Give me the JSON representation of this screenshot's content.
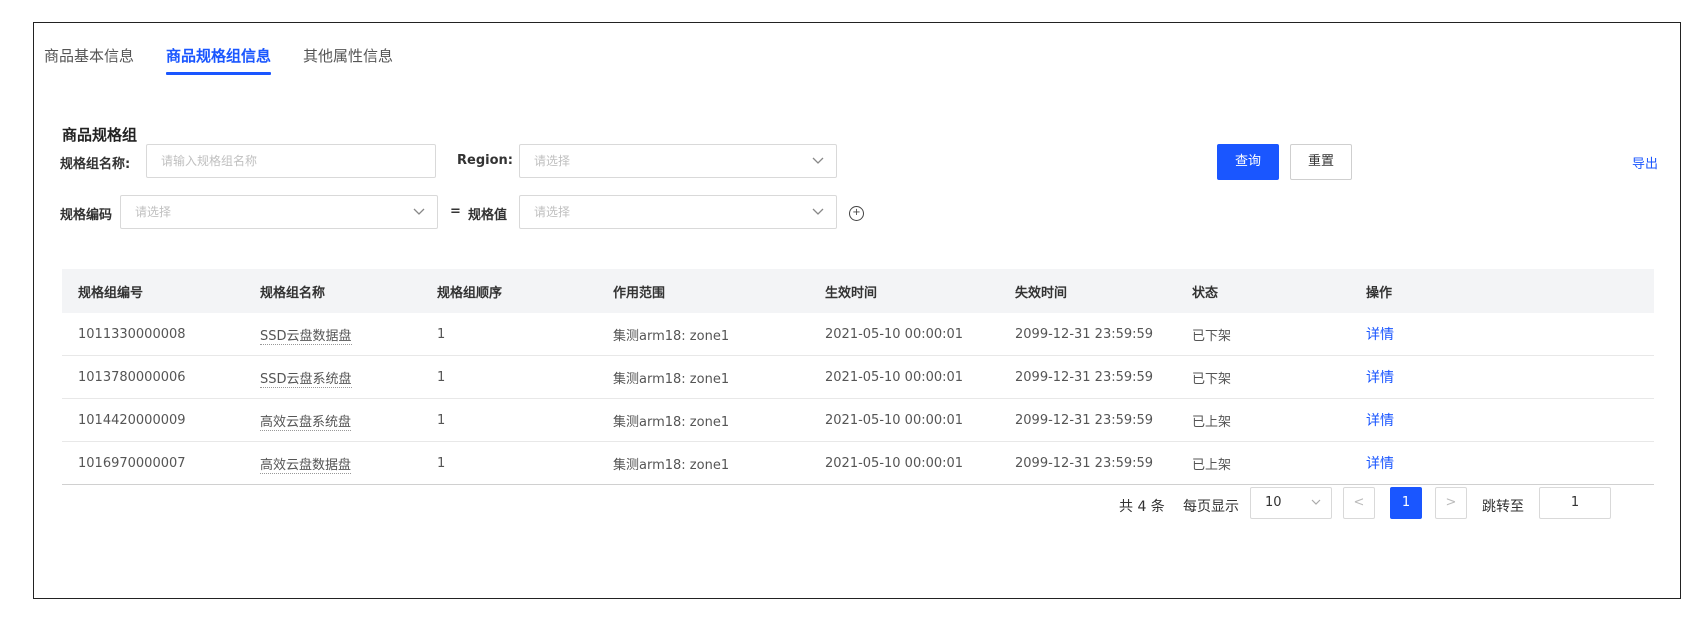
{
  "tabs": [
    {
      "label": "商品基本信息",
      "active": false
    },
    {
      "label": "商品规格组信息",
      "active": true
    },
    {
      "label": "其他属性信息",
      "active": false
    }
  ],
  "section_title": "商品规格组",
  "filters": {
    "group_name_label": "规格组名称:",
    "group_name_placeholder": "请输入规格组名称",
    "region_label": "Region:",
    "region_placeholder": "请选择",
    "spec_code_label": "规格编码",
    "spec_code_placeholder": "请选择",
    "equals": "=",
    "spec_value_label": "规格值",
    "spec_value_placeholder": "请选择"
  },
  "buttons": {
    "query": "查询",
    "reset": "重置",
    "export": "导出"
  },
  "table": {
    "headers": [
      "规格组编号",
      "规格组名称",
      "规格组顺序",
      "作用范围",
      "生效时间",
      "失效时间",
      "状态",
      "操作"
    ],
    "rows": [
      [
        "1011330000008",
        "SSD云盘数据盘",
        "1",
        "集测arm18: zone1",
        "2021-05-10 00:00:01",
        "2099-12-31 23:59:59",
        "已下架",
        "详情"
      ],
      [
        "1013780000006",
        "SSD云盘系统盘",
        "1",
        "集测arm18: zone1",
        "2021-05-10 00:00:01",
        "2099-12-31 23:59:59",
        "已下架",
        "详情"
      ],
      [
        "1014420000009",
        "高效云盘系统盘",
        "1",
        "集测arm18: zone1",
        "2021-05-10 00:00:01",
        "2099-12-31 23:59:59",
        "已上架",
        "详情"
      ],
      [
        "1016970000007",
        "高效云盘数据盘",
        "1",
        "集测arm18: zone1",
        "2021-05-10 00:00:01",
        "2099-12-31 23:59:59",
        "已上架",
        "详情"
      ]
    ]
  },
  "pagination": {
    "total": "共 4 条",
    "per_page_label": "每页显示",
    "per_page": "10",
    "current_page": "1",
    "jump_label": "跳转至",
    "jump_value": "1",
    "prev": "<",
    "next": ">"
  },
  "icons": {
    "chevron": "chevron-down-icon",
    "add": "add-circle-icon"
  },
  "colors": {
    "accent": "#1a56ff"
  }
}
